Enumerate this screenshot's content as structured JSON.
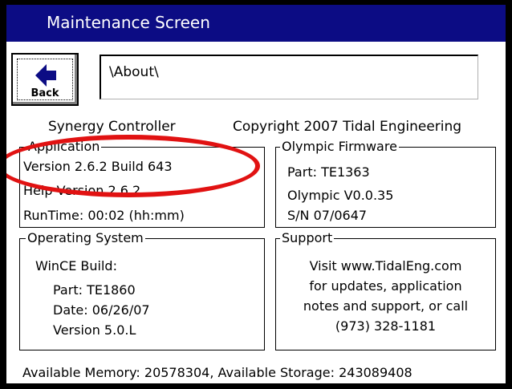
{
  "window": {
    "title": "Maintenance Screen"
  },
  "toolbar": {
    "back_label": "Back",
    "path_value": "\\About\\"
  },
  "header": {
    "product": "Synergy Controller",
    "copyright": "Copyright 2007 Tidal Engineering"
  },
  "application": {
    "legend": "Application",
    "version": "Version 2.6.2 Build 643",
    "help_version": "Help Version 2.6.2",
    "runtime": "RunTime: 00:02 (hh:mm)"
  },
  "firmware": {
    "legend": "Olympic Firmware",
    "part": "Part: TE1363",
    "version": "Olympic V0.0.35",
    "serial": "S/N  07/0647"
  },
  "os": {
    "legend": "Operating System",
    "build_label": "WinCE Build:",
    "part": "Part: TE1860",
    "date": "Date: 06/26/07",
    "version": "Version 5.0.L"
  },
  "support": {
    "legend": "Support",
    "line1": "Visit www.TidalEng.com",
    "line2": "for updates, application",
    "line3": "notes and support, or call",
    "line4": "(973) 328-1181"
  },
  "footer": {
    "memory": "Available Memory: 20578304, Available Storage: 243089408"
  },
  "colors": {
    "titlebar": "#0c0c84",
    "annotation": "#e11212",
    "bezel": "#000000",
    "screen": "#ffffff"
  },
  "icons": {
    "back": "left-arrow-icon"
  }
}
